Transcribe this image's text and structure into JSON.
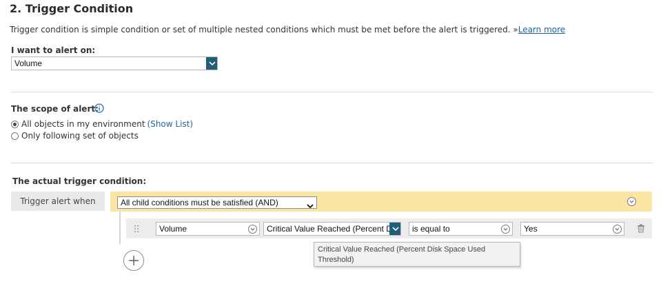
{
  "section": {
    "title": "2. Trigger Condition",
    "description": "Trigger condition is simple condition or set of multiple nested conditions which must be met before the alert is triggered. »",
    "learn_more": "Learn more"
  },
  "alert_on": {
    "label": "I want to alert on:",
    "value": "Volume"
  },
  "scope": {
    "label": "The scope of alert:",
    "options": [
      {
        "label": "All objects in my environment",
        "selected": true
      },
      {
        "label": "Only following set of objects",
        "selected": false
      }
    ],
    "show_list": "(Show List)"
  },
  "trigger": {
    "label": "The actual trigger condition:",
    "trigger_when": "Trigger alert when",
    "group_select": "All child conditions must be satisfied (AND)",
    "condition": {
      "object": "Volume",
      "field": "Critical Value Reached (Percent Disk Space Used Threshold)",
      "operator": "is equal to",
      "value": "Yes"
    },
    "tooltip": "Critical Value Reached (Percent Disk Space Used Threshold)"
  },
  "colors": {
    "accent_teal": "#1f5f7a",
    "link_blue": "#1a66a8",
    "and_band": "#fbe5a5"
  }
}
